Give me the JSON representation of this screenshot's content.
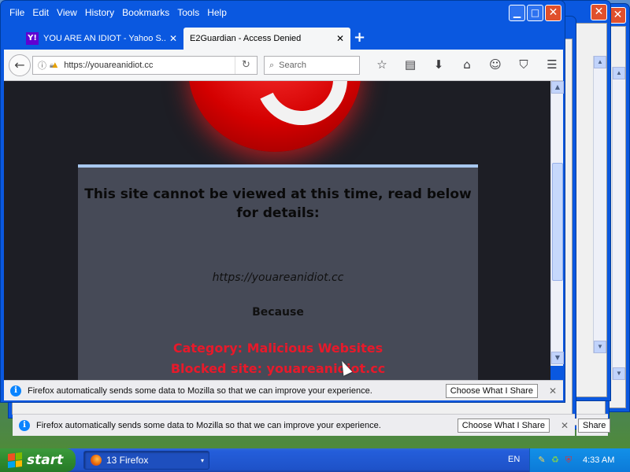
{
  "menu": [
    "File",
    "Edit",
    "View",
    "History",
    "Bookmarks",
    "Tools",
    "Help"
  ],
  "window_buttons": {
    "minimize": "▁",
    "maximize": "□",
    "close": "✕"
  },
  "tabs": [
    {
      "favicon": "Y!",
      "label": "YOU ARE AN IDIOT - Yahoo S...",
      "close": "✕"
    },
    {
      "label": "E2Guardian - Access Denied",
      "close": "✕"
    }
  ],
  "new_tab_label": "+",
  "nav": {
    "back_icon": "←",
    "url": "https://youareanidiot.cc",
    "reload_icon": "↻",
    "search_placeholder": "Search",
    "toolbar_icons": [
      "☆",
      "▤",
      "⬇",
      "⌂",
      "☺",
      "⛉",
      "☰"
    ]
  },
  "page": {
    "heading": "This site cannot be viewed at this time, read below for details:",
    "blocked_url": "https://youareanidiot.cc",
    "because": "Because",
    "category": "Category: Malicious Websites",
    "blocked_site": "Blocked site: youareanidiot.cc"
  },
  "notification": {
    "message": "Firefox automatically sends some data to Mozilla so that we can improve your experience.",
    "button": "Choose What I Share",
    "close": "✕",
    "info": "i"
  },
  "background_notification_button_partial": "Share",
  "taskbar": {
    "start": "start",
    "task_label": "13 Firefox",
    "task_arrow": "▾",
    "language": "EN",
    "clock": "4:33 AM"
  },
  "scroll": {
    "up": "▲",
    "down": "▼"
  },
  "colors": {
    "accent_red": "#e8192a",
    "titlebar_blue": "#0a58e0",
    "panel_bg": "#464a57",
    "close_red": "#e0502c"
  }
}
